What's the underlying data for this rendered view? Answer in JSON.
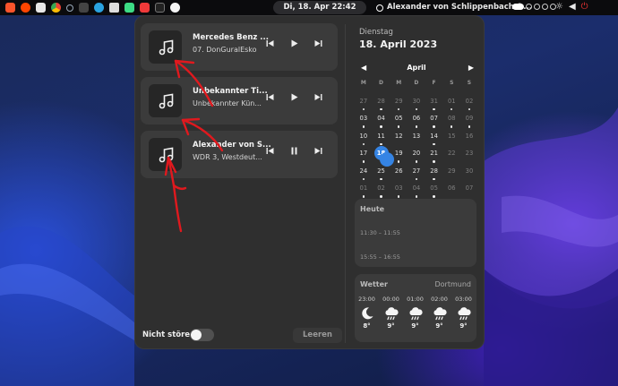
{
  "topbar": {
    "clock": "Di, 18. Apr  22:42",
    "media_title": "Alexander von Schlippenbach &...",
    "app_icons": [
      "brave-icon",
      "reddit-icon",
      "files-icon",
      "chrome-icon",
      "search-icon",
      "slack-icon",
      "telegram-icon",
      "audio-icon",
      "android-icon",
      "vivaldi-icon",
      "terminal-icon",
      "app-icon"
    ],
    "system_icons": [
      "brightness-icon",
      "volume-icon",
      "power-icon"
    ]
  },
  "notifications": [
    {
      "title": "Mercedes Benz ...",
      "subtitle": "07. DonGuralEsko",
      "state": "paused"
    },
    {
      "title": "Unbekannter Ti...",
      "subtitle": "Unbekannter Kün...",
      "state": "paused"
    },
    {
      "title": "Alexander von S...",
      "subtitle": "WDR 3, Westdeut...",
      "state": "playing"
    }
  ],
  "footer": {
    "dnd_label": "Nicht stören",
    "dnd_on": false,
    "clear_label": "Leeren"
  },
  "calendar": {
    "weekday": "Dienstag",
    "date": "18. April 2023",
    "month": "April",
    "headers": [
      "M",
      "D",
      "M",
      "D",
      "F",
      "S",
      "S"
    ],
    "weeks": [
      [
        {
          "d": "27",
          "dim": true,
          "ev": true
        },
        {
          "d": "28",
          "dim": true,
          "ev": true
        },
        {
          "d": "29",
          "dim": true,
          "ev": true
        },
        {
          "d": "30",
          "dim": true,
          "ev": true
        },
        {
          "d": "31",
          "dim": true,
          "ev": true
        },
        {
          "d": "01",
          "dim": true,
          "ev": true
        },
        {
          "d": "02",
          "dim": true,
          "ev": true
        }
      ],
      [
        {
          "d": "03",
          "ev": true
        },
        {
          "d": "04",
          "ev": true
        },
        {
          "d": "05",
          "ev": true
        },
        {
          "d": "06",
          "ev": true
        },
        {
          "d": "07",
          "ev": true
        },
        {
          "d": "08",
          "dim": true,
          "ev": true
        },
        {
          "d": "09",
          "dim": true,
          "ev": true
        }
      ],
      [
        {
          "d": "10",
          "ev": true
        },
        {
          "d": "11",
          "ev": true
        },
        {
          "d": "12",
          "ev": false
        },
        {
          "d": "13",
          "ev": false
        },
        {
          "d": "14",
          "ev": true
        },
        {
          "d": "15",
          "dim": true,
          "ev": false
        },
        {
          "d": "16",
          "dim": true,
          "ev": false
        }
      ],
      [
        {
          "d": "17",
          "ev": true
        },
        {
          "d": "18",
          "today": true,
          "ev": true
        },
        {
          "d": "19",
          "ev": true
        },
        {
          "d": "20",
          "ev": true
        },
        {
          "d": "21",
          "ev": true
        },
        {
          "d": "22",
          "dim": true,
          "ev": false
        },
        {
          "d": "23",
          "dim": true,
          "ev": false
        }
      ],
      [
        {
          "d": "24",
          "ev": true
        },
        {
          "d": "25",
          "ev": true
        },
        {
          "d": "26",
          "ev": false
        },
        {
          "d": "27",
          "ev": true
        },
        {
          "d": "28",
          "ev": true
        },
        {
          "d": "29",
          "dim": true,
          "ev": false
        },
        {
          "d": "30",
          "dim": true,
          "ev": false
        }
      ],
      [
        {
          "d": "01",
          "dim": true,
          "ev": true
        },
        {
          "d": "02",
          "dim": true,
          "ev": true
        },
        {
          "d": "03",
          "dim": true,
          "ev": true
        },
        {
          "d": "04",
          "dim": true,
          "ev": true
        },
        {
          "d": "05",
          "dim": true,
          "ev": true
        },
        {
          "d": "06",
          "dim": true,
          "ev": false
        },
        {
          "d": "07",
          "dim": true,
          "ev": false
        }
      ]
    ]
  },
  "today_card": {
    "title": "Heute",
    "events": [
      "11:30 – 11:55",
      "15:55 – 16:55"
    ]
  },
  "weather": {
    "title": "Wetter",
    "location": "Dortmund",
    "hours": [
      {
        "time": "23:00",
        "icon": "moon-icon",
        "temp": "8°"
      },
      {
        "time": "00:00",
        "icon": "cloud-rain-icon",
        "temp": "9°"
      },
      {
        "time": "01:00",
        "icon": "cloud-rain-icon",
        "temp": "9°"
      },
      {
        "time": "02:00",
        "icon": "cloud-rain-icon",
        "temp": "9°"
      },
      {
        "time": "03:00",
        "icon": "cloud-rain-icon",
        "temp": "9°"
      }
    ]
  },
  "colors": {
    "accent": "#3584e4",
    "annotation": "#e0191e",
    "panel": "#2f2f2f",
    "card": "#3b3b3b"
  }
}
